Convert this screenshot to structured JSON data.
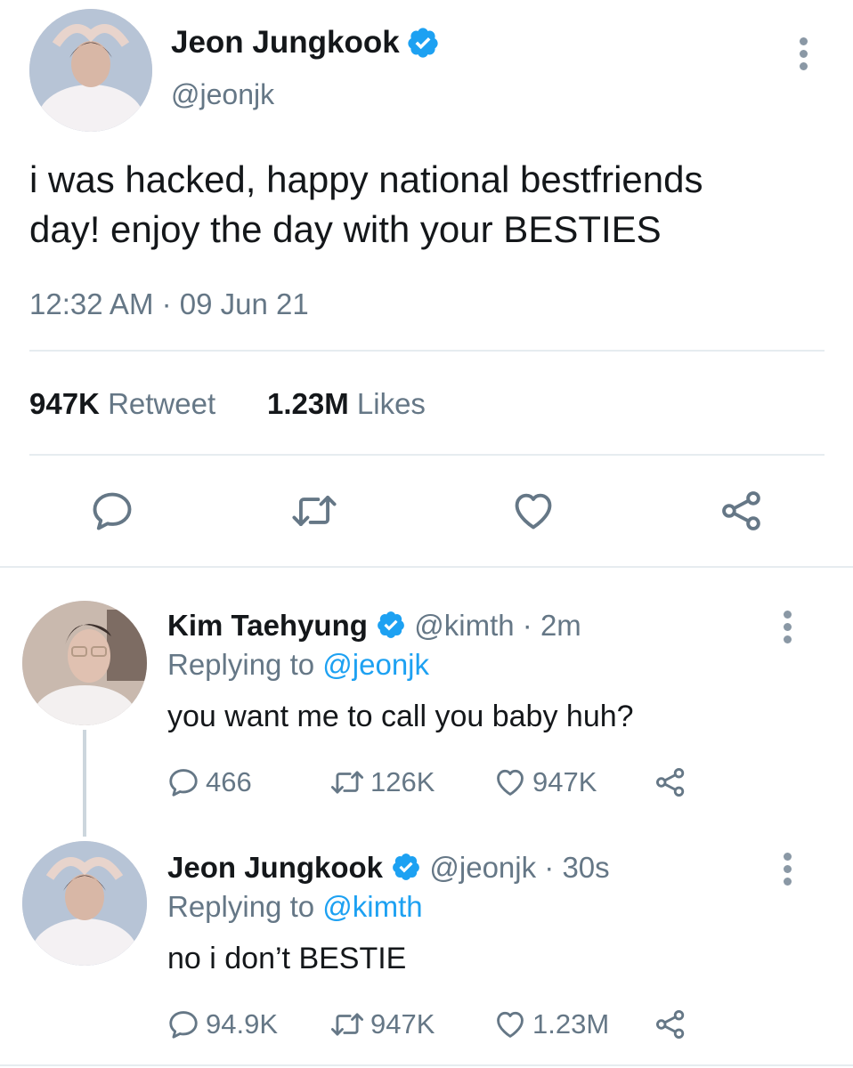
{
  "main_tweet": {
    "display_name": "Jeon Jungkook",
    "handle": "@jeonjk",
    "text_line1": "i was hacked, happy national bestfriends",
    "text_line2": "day! enjoy the day with your BESTIES",
    "timestamp": "12:32 AM · 09 Jun 21",
    "retweet_count": "947K",
    "retweet_label": "Retweet",
    "like_count": "1.23M",
    "like_label": "Likes",
    "icons": [
      "reply-icon",
      "retweet-icon",
      "heart-icon",
      "share-icon"
    ]
  },
  "replies": [
    {
      "display_name": "Kim Taehyung",
      "handle": "@kimth",
      "time": "· 2m",
      "replying_prefix": "Replying to",
      "replying_to": "@jeonjk",
      "text": "you want me to call you baby huh?",
      "reply_count": "466",
      "retweet_count": "126K",
      "like_count": "947K"
    },
    {
      "display_name": "Jeon Jungkook",
      "handle": "@jeonjk",
      "time": "· 30s",
      "replying_prefix": "Replying to",
      "replying_to": "@kimth",
      "text": "no i don’t BESTIE",
      "reply_count": "94.9K",
      "retweet_count": "947K",
      "like_count": "1.23M"
    }
  ],
  "colors": {
    "accent": "#1da1f2",
    "secondary_text": "#657786",
    "icon": "#657786",
    "divider": "#e6ecf0"
  }
}
